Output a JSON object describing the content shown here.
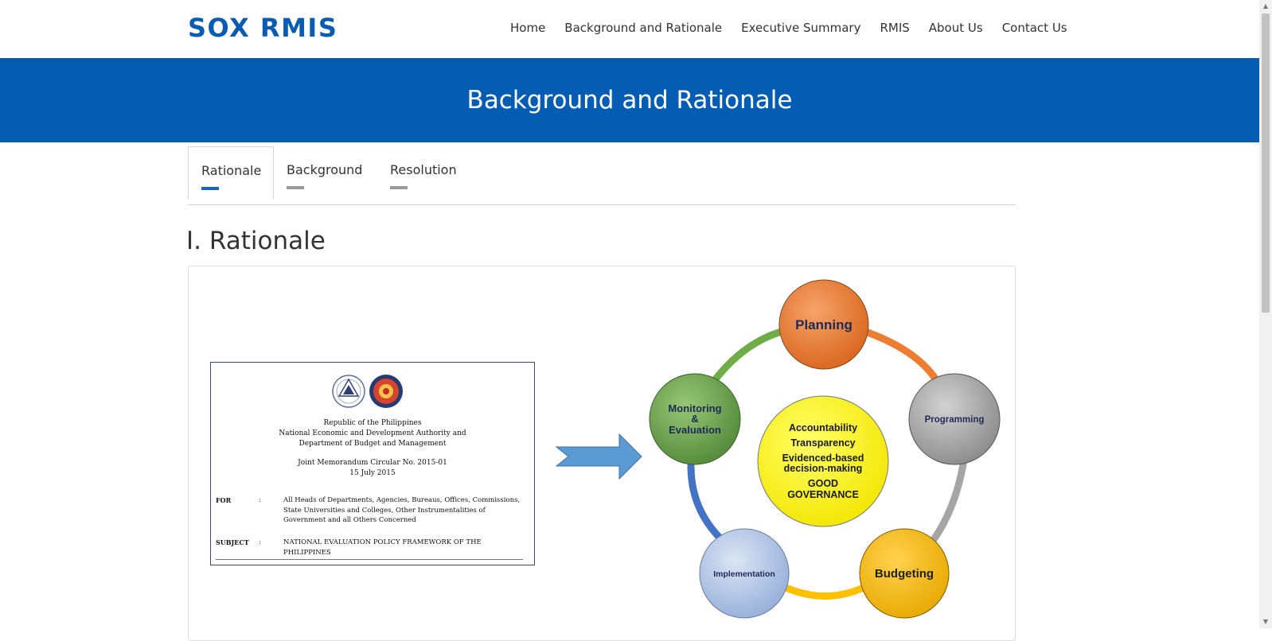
{
  "brand": {
    "logo": "SOX RMIS",
    "color": "#0a5cb3"
  },
  "nav": {
    "items": [
      "Home",
      "Background and Rationale",
      "Executive Summary",
      "RMIS",
      "About Us",
      "Contact Us"
    ]
  },
  "banner": {
    "title": "Background and Rationale",
    "color": "#055db3"
  },
  "tabs": {
    "items": [
      "Rationale",
      "Background",
      "Resolution"
    ],
    "active": "Rationale"
  },
  "section": {
    "title": "I. Rationale"
  },
  "memo": {
    "header1": "Republic of the Philippines",
    "header2": "National Economic and Development Authority and",
    "header3": "Department of Budget and Management",
    "circular": "Joint Memorandum Circular No. 2015-01",
    "date": "15 July 2015",
    "for_label": "FOR",
    "colon": ":",
    "for_text": "All Heads of Departments, Agencies, Bureaus, Offices, Commissions, State Universities and Colleges, Other Instrumentalities of Government and all Others Concerned",
    "subject_label": "SUBJECT",
    "subject_text": "NATIONAL EVALUATION POLICY FRAMEWORK OF THE PHILIPPINES"
  },
  "cycle": {
    "nodes": {
      "planning": "Planning",
      "programming": "Programming",
      "budgeting": "Budgeting",
      "implementation": "Implementation",
      "monitoring_line1": "Monitoring",
      "monitoring_line2": "&",
      "monitoring_line3": "Evaluation"
    },
    "center": {
      "line1": "Accountability",
      "line2": "Transparency",
      "line3": "Evidenced-based",
      "line4": "decision-making",
      "line5": "GOOD",
      "line6": "GOVERNANCE"
    },
    "colors": {
      "planning": "#ed7d31",
      "programming": "#a5a5a5",
      "budgeting": "#ffc000",
      "implementation": "#b4c7e7",
      "monitoring": "#70ad47",
      "center": "#ffff00",
      "arrow": "#5b9bd5"
    }
  }
}
